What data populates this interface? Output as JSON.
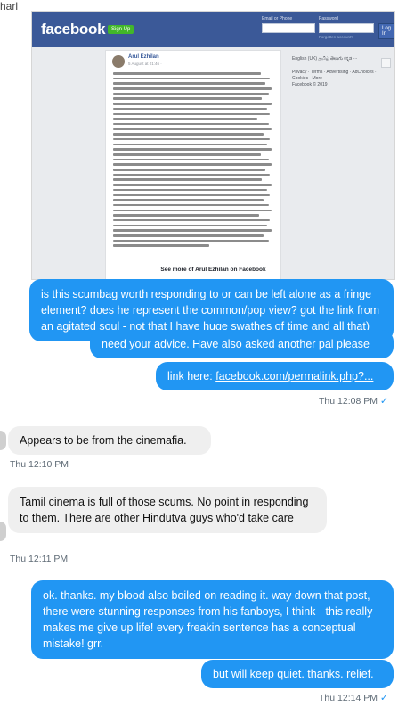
{
  "header": {
    "contact_name": "harl"
  },
  "fb": {
    "logo": "facebook",
    "signup": "Sign Up",
    "email_label": "Email or Phone",
    "password_label": "Password",
    "login": "Log In",
    "forgot": "Forgotten account?",
    "author": "Arul Ezhilan",
    "date": "5 August at 01:46 · ",
    "side_lang": "English (UK) தமிழ் తెలుగు ಕನ್ನಡ ···",
    "side_links": "Privacy · Terms · Advertising · AdChoices · Cookies · More ·",
    "side_copy": "Facebook © 2019",
    "plus": "+",
    "see_more": "See more of Arul Ezhilan on Facebook"
  },
  "messages": [
    {
      "dir": "out",
      "text": "is this scumbag worth responding to or can be left alone as a fringe element? does he represent the common/pop view? got the link from an agitated soul - not that I have huge swathes of time and all that)"
    },
    {
      "dir": "out",
      "text": "need your advice. Have also asked another pal please"
    },
    {
      "dir": "out",
      "prefix": "link here: ",
      "link": "facebook.com/permalink.php?..."
    },
    {
      "dir": "in",
      "text": "Appears to be from the cinemafia."
    },
    {
      "dir": "in",
      "text": "Tamil cinema is full of those scums.  No point in responding to them.  There are other Hindutva guys who'd take care"
    },
    {
      "dir": "out",
      "text": "ok. thanks. my blood also boiled on reading it. way down that post, there were stunning responses from his fanboys, I think - this really makes me give up life! every freakin sentence has a conceptual mistake! grr."
    },
    {
      "dir": "out",
      "text": "but will keep quiet. thanks. relief."
    }
  ],
  "timestamps": {
    "t1": "Thu 12:08 PM",
    "t2": "Thu 12:10 PM",
    "t3": "Thu 12:11 PM",
    "t4": "Thu 12:14 PM"
  },
  "icons": {
    "read_tick": "✓"
  },
  "colors": {
    "outgoing": "#2196f3",
    "incoming": "#efefef",
    "fb_blue": "#3b5998"
  }
}
